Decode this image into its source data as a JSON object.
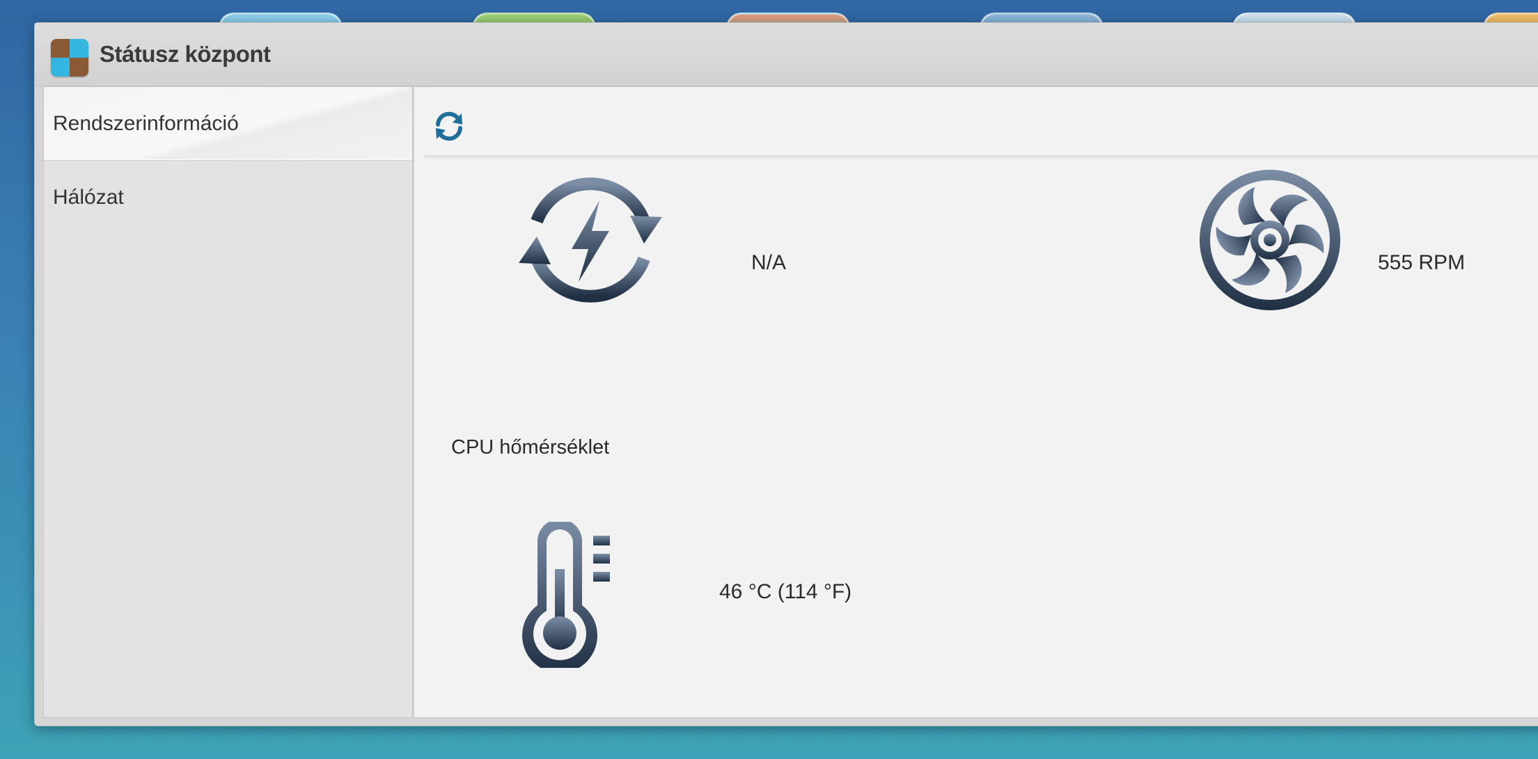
{
  "window": {
    "title": "Státusz központ",
    "app_icon": "status-center-icon"
  },
  "sidebar": {
    "items": [
      {
        "label": "Rendszerinformáció",
        "active": true
      },
      {
        "label": "Hálózat",
        "active": false
      }
    ]
  },
  "toolbar": {
    "refresh_icon": "refresh-icon"
  },
  "stats": {
    "power_recovery": {
      "icon": "power-cycle-icon",
      "value": "N/A"
    },
    "fan": {
      "icon": "fan-icon",
      "value": "555 RPM"
    },
    "cpu_temp": {
      "label": "CPU hőmérséklet",
      "icon": "thermometer-icon",
      "value": "46 °C (114 °F)"
    }
  },
  "colors": {
    "icon_gradient_top": "#7b8ea6",
    "icon_gradient_bottom": "#1f2f44",
    "refresh_blue": "#1f6f9a"
  }
}
